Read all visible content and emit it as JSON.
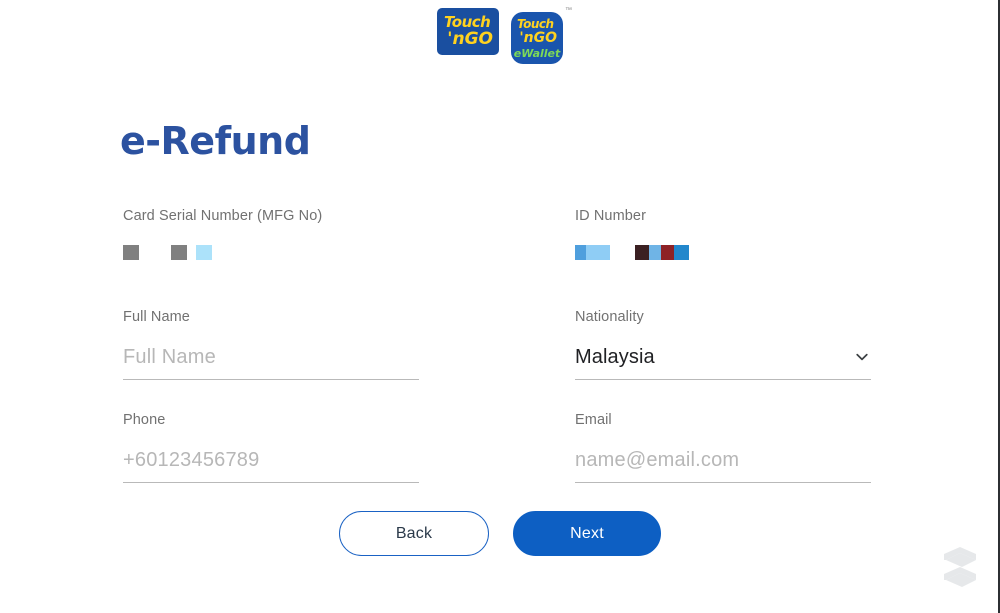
{
  "header": {
    "logos": [
      {
        "name": "touch-n-go-logo",
        "line1": "Touch",
        "line2": "'nGO",
        "sub": "",
        "tm": ""
      },
      {
        "name": "touch-n-go-ewallet-logo",
        "line1": "Touch",
        "line2": "'nGO",
        "sub": "eWallet",
        "tm": "™"
      }
    ]
  },
  "page": {
    "title": "e-Refund"
  },
  "form": {
    "card_serial": {
      "label": "Card Serial Number (MFG No)",
      "redacted": true,
      "blocks_group_1": [
        "#808080"
      ],
      "blocks_group_2": [
        "#808080",
        "#ace2fa"
      ]
    },
    "id_number": {
      "label": "ID Number",
      "redacted": true,
      "blocks_group_1": [
        "#4f9fdd",
        "#8fcdf5"
      ],
      "blocks_group_2": [
        "#3b2022",
        "#6fb4e6",
        "#8e2226",
        "#2287cc"
      ]
    },
    "full_name": {
      "label": "Full Name",
      "value": "",
      "placeholder": "Full Name"
    },
    "nationality": {
      "label": "Nationality",
      "value": "Malaysia",
      "icon": "chevron-down-icon",
      "options": [
        "Malaysia"
      ]
    },
    "phone": {
      "label": "Phone",
      "value": "",
      "placeholder": "+60123456789"
    },
    "email": {
      "label": "Email",
      "value": "",
      "placeholder": "name@email.com"
    }
  },
  "actions": {
    "back_label": "Back",
    "next_label": "Next"
  },
  "theme": {
    "title_color": "#2c52a0",
    "primary_button": "#0d5fc3",
    "secondary_border": "#1a62c4",
    "label_color": "#717171",
    "placeholder_color": "#b7b7b7"
  },
  "watermark": {
    "name": "brand-watermark-icon"
  }
}
